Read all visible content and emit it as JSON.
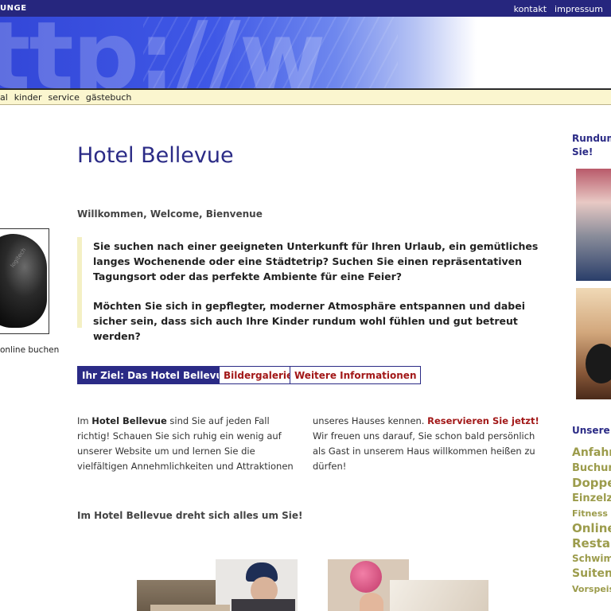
{
  "topbar": {
    "brand": "UNGE",
    "links": [
      "kontakt",
      "impressum"
    ]
  },
  "banner": {
    "decor_text": "ttp://w"
  },
  "nav": {
    "items": [
      "al",
      "kinder",
      "service",
      "gästebuch"
    ]
  },
  "main": {
    "title": "Hotel Bellevue",
    "welcome": "Willkommen, Welcome, Bienvenue",
    "intro": [
      "Sie suchen nach einer geeigneten Unterkunft für Ihren Urlaub, ein gemütliches langes Wochenende oder eine Städtetrip? Suchen Sie einen repräsentativen Tagungsort oder das perfekte Ambiente für eine Feier?",
      "Möchten Sie sich in gepflegter, moderner Atmosphäre entspannen und dabei sicher sein, dass sich auch Ihre Kinder rundum wohl fühlen und gut betreut werden?"
    ],
    "buttons": [
      "Ihr Ziel: Das Hotel Bellevue",
      "Bildergalerie",
      "Weitere Informationen"
    ],
    "col1": {
      "pre": "Im ",
      "bold": "Hotel Bellevue",
      "post": " sind Sie auf jeden Fall richtig! Schauen Sie sich ruhig ein wenig auf unserer Website um und lernen Sie die vielfältigen Annehmlichkeiten und Attraktionen"
    },
    "col2": {
      "pre": "unseres Hauses kennen. ",
      "link": "Reservieren Sie jetzt!",
      "post": " Wir freuen uns darauf, Sie schon bald persönlich als Gast in unserem Haus willkommen heißen zu dürfen!"
    },
    "subhead": "Im Hotel Bellevue dreht sich alles um Sie!"
  },
  "left": {
    "mouse_logo": "logitech",
    "online_buchen": "online buchen"
  },
  "right": {
    "heading_line1": "Rundum",
    "heading_line2": "Sie!",
    "unsere": "Unsere",
    "tags": [
      {
        "text": "Anfahrt",
        "size": 14
      },
      {
        "text": "Buchung",
        "size": 13
      },
      {
        "text": "Doppel",
        "size": 15
      },
      {
        "text": "Einzelzi",
        "size": 13
      },
      {
        "text": "Fitness c",
        "size": 11
      },
      {
        "text": "Online",
        "size": 15
      },
      {
        "text": "Restau",
        "size": 15
      },
      {
        "text": "Schwim",
        "size": 12
      },
      {
        "text": "Suiten",
        "size": 14
      },
      {
        "text": "Vorspeis",
        "size": 11
      }
    ]
  },
  "colors": {
    "navy": "#2b2b86",
    "red": "#a21818",
    "cream": "#fbf6cf",
    "olive": "#9c9c4c"
  }
}
